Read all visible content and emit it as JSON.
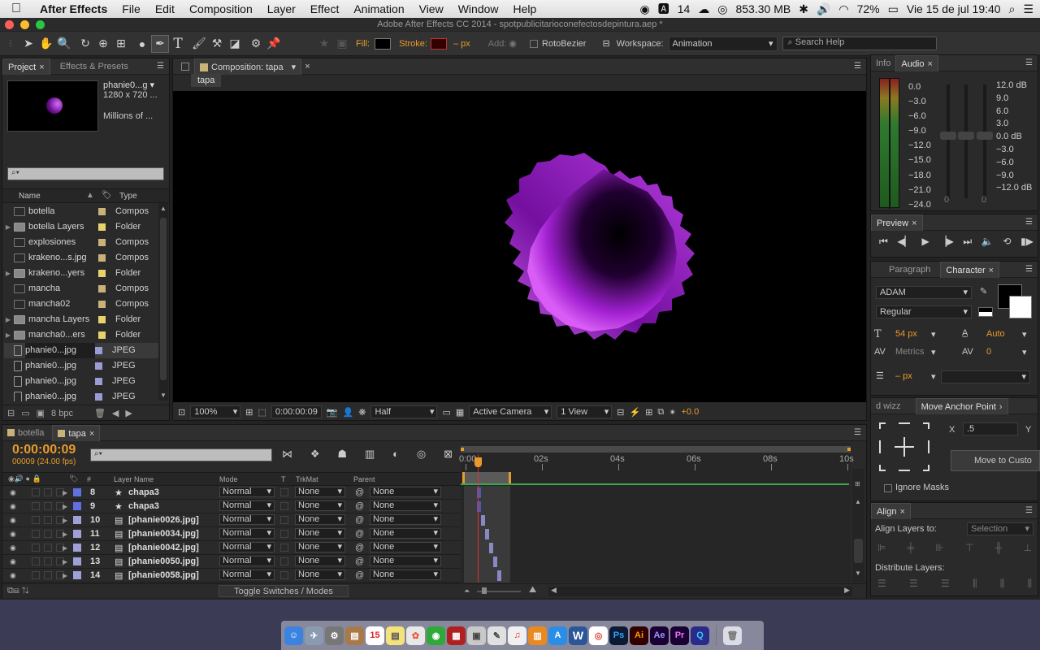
{
  "menubar": {
    "app": "After Effects",
    "items": [
      "File",
      "Edit",
      "Composition",
      "Layer",
      "Effect",
      "Animation",
      "View",
      "Window",
      "Help"
    ],
    "status": {
      "notif_count": "14",
      "memory": "853.30 MB",
      "battery": "72%",
      "datetime": "Vie 15 de jul  19:40"
    }
  },
  "window_title": "Adobe After Effects CC 2014 - spotpublicitarioconefectosdepintura.aep *",
  "toolbar": {
    "fill_label": "Fill:",
    "stroke_label": "Stroke:",
    "stroke_px": "– px",
    "add_label": "Add:",
    "rotobezier": "RotoBezier",
    "workspace_label": "Workspace:",
    "workspace": "Animation",
    "search_placeholder": "Search Help"
  },
  "project": {
    "tabs": [
      "Project",
      "Effects & Presets"
    ],
    "preview_name": "phanie0...g ▾",
    "preview_dims": "1280 x 720 ...",
    "preview_colors": "Millions of ...",
    "col_name": "Name",
    "col_type": "Type",
    "items": [
      {
        "name": "botella",
        "type": "Compos",
        "kind": "comp",
        "label": "#c9b27a",
        "tri": false
      },
      {
        "name": "botella Layers",
        "type": "Folder",
        "kind": "folder",
        "label": "#e7d36b",
        "tri": true
      },
      {
        "name": "explosiones",
        "type": "Compos",
        "kind": "comp",
        "label": "#c9b27a",
        "tri": false
      },
      {
        "name": "krakeno...s.jpg",
        "type": "Compos",
        "kind": "comp",
        "label": "#c9b27a",
        "tri": false
      },
      {
        "name": "krakeno...yers",
        "type": "Folder",
        "kind": "folder",
        "label": "#e7d36b",
        "tri": true
      },
      {
        "name": "mancha",
        "type": "Compos",
        "kind": "comp",
        "label": "#c9b27a",
        "tri": false
      },
      {
        "name": "mancha02",
        "type": "Compos",
        "kind": "comp",
        "label": "#c9b27a",
        "tri": false
      },
      {
        "name": "mancha Layers",
        "type": "Folder",
        "kind": "folder",
        "label": "#e7d36b",
        "tri": true
      },
      {
        "name": "mancha0...ers",
        "type": "Folder",
        "kind": "folder",
        "label": "#e7d36b",
        "tri": true
      },
      {
        "name": "phanie0...jpg",
        "type": "JPEG",
        "kind": "file",
        "label": "#9c9cd4",
        "tri": false
      },
      {
        "name": "phanie0...jpg",
        "type": "JPEG",
        "kind": "file",
        "label": "#9c9cd4",
        "tri": false
      },
      {
        "name": "phanie0...jpg",
        "type": "JPEG",
        "kind": "file",
        "label": "#9c9cd4",
        "tri": false
      },
      {
        "name": "phanie0...jpg",
        "type": "JPEG",
        "kind": "file",
        "label": "#9c9cd4",
        "tri": false
      }
    ],
    "bpc": "8 bpc"
  },
  "composition": {
    "tab": "Composition: tapa",
    "flow_tab": "tapa",
    "zoom": "100%",
    "timecode": "0:00:00:09",
    "resolution": "Half",
    "camera": "Active Camera",
    "views": "1 View",
    "exposure": "+0.0"
  },
  "timeline": {
    "tabs": [
      "botella",
      "tapa"
    ],
    "timecode": "0:00:00:09",
    "frames": "00009 (24.00 fps)",
    "headers": {
      "num": "#",
      "layer_name": "Layer Name",
      "mode": "Mode",
      "t": "T",
      "trkmat": "TrkMat",
      "parent": "Parent"
    },
    "ruler": [
      "0:00",
      "02s",
      "04s",
      "06s",
      "08s",
      "10s"
    ],
    "layers": [
      {
        "num": "8",
        "name": "chapa3",
        "mode": "Normal",
        "trkmat": "None",
        "parent": "None",
        "color": "#6070e0",
        "star": true
      },
      {
        "num": "9",
        "name": "chapa3",
        "mode": "Normal",
        "trkmat": "None",
        "parent": "None",
        "color": "#6070e0",
        "star": true
      },
      {
        "num": "10",
        "name": "[phanie0026.jpg]",
        "mode": "Normal",
        "trkmat": "None",
        "parent": "None",
        "color": "#a0a0d8",
        "star": false
      },
      {
        "num": "11",
        "name": "[phanie0034.jpg]",
        "mode": "Normal",
        "trkmat": "None",
        "parent": "None",
        "color": "#a0a0d8",
        "star": false
      },
      {
        "num": "12",
        "name": "[phanie0042.jpg]",
        "mode": "Normal",
        "trkmat": "None",
        "parent": "None",
        "color": "#a0a0d8",
        "star": false
      },
      {
        "num": "13",
        "name": "[phanie0050.jpg]",
        "mode": "Normal",
        "trkmat": "None",
        "parent": "None",
        "color": "#a0a0d8",
        "star": false
      },
      {
        "num": "14",
        "name": "[phanie0058.jpg]",
        "mode": "Normal",
        "trkmat": "None",
        "parent": "None",
        "color": "#a0a0d8",
        "star": false
      }
    ],
    "toggle_label": "Toggle Switches / Modes"
  },
  "info_audio": {
    "tabs": [
      "Info",
      "Audio"
    ],
    "left_scale": [
      "0.0",
      "−3.0",
      "−6.0",
      "−9.0",
      "−12.0",
      "−15.0",
      "−18.0",
      "−21.0",
      "−24.0"
    ],
    "right_scale": [
      "12.0 dB",
      "9.0",
      "6.0",
      "3.0",
      "0.0 dB",
      "−3.0",
      "−6.0",
      "−9.0",
      "−12.0 dB"
    ],
    "slider_zero_l": "0",
    "slider_zero_r": "0"
  },
  "preview": {
    "tab": "Preview"
  },
  "character": {
    "tabs": [
      "Paragraph",
      "Character"
    ],
    "font": "ADAM",
    "style": "Regular",
    "size": "54 px",
    "leading": "Auto",
    "kerning": "Metrics",
    "tracking": "0",
    "stroke_width": "– px"
  },
  "anchor": {
    "tabs": [
      "d wizz",
      "Move Anchor Point"
    ],
    "x_label": "X",
    "x_value": ".5",
    "y_label": "Y",
    "move_button": "Move to Custo",
    "ignore_masks": "Ignore Masks"
  },
  "align": {
    "tab": "Align",
    "align_to_label": "Align Layers to:",
    "align_to": "Selection",
    "distribute_label": "Distribute Layers:"
  },
  "accent_color": "#e89b2b"
}
